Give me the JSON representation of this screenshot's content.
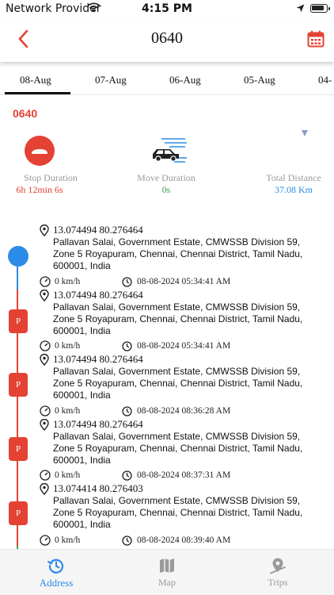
{
  "status_bar": {
    "carrier": "Network Provider",
    "time": "4:15 PM"
  },
  "header": {
    "title": "0640",
    "back_icon": "chevron-left-icon",
    "calendar_icon": "calendar-icon",
    "accent": "#e34234"
  },
  "date_tabs": [
    {
      "label": "08-Aug",
      "active": true
    },
    {
      "label": "07-Aug",
      "active": false
    },
    {
      "label": "06-Aug",
      "active": false
    },
    {
      "label": "05-Aug",
      "active": false
    },
    {
      "label": "04-",
      "active": false
    }
  ],
  "vehicle_id": "0640",
  "stats": {
    "stop_duration": {
      "label": "Stop Duration",
      "value": "6h 12min 6s",
      "color": "#e34234"
    },
    "move_duration": {
      "label": "Move Duration",
      "value": "0s",
      "color": "#3aa24a"
    },
    "total_distance": {
      "label": "Total Distance",
      "value": "37.08 Km",
      "color": "#2c8be6"
    }
  },
  "entries": [
    {
      "coords": "13.074494 80.276464",
      "address": "Pallavan Salai, Government Estate, CMWSSB Division 59, Zone 5 Royapuram, Chennai, Chennai District, Tamil Nadu, 600001, India",
      "speed": "0 km/h",
      "timestamp": "08-08-2024 05:34:41 AM"
    },
    {
      "coords": "13.074494 80.276464",
      "address": "Pallavan Salai, Government Estate, CMWSSB Division 59, Zone 5 Royapuram, Chennai, Chennai District, Tamil Nadu, 600001, India",
      "speed": "0 km/h",
      "timestamp": "08-08-2024 05:34:41 AM"
    },
    {
      "coords": "13.074494 80.276464",
      "address": "Pallavan Salai, Government Estate, CMWSSB Division 59, Zone 5 Royapuram, Chennai, Chennai District, Tamil Nadu, 600001, India",
      "speed": "0 km/h",
      "timestamp": "08-08-2024 08:36:28 AM"
    },
    {
      "coords": "13.074494 80.276464",
      "address": "Pallavan Salai, Government Estate, CMWSSB Division 59, Zone 5 Royapuram, Chennai, Chennai District, Tamil Nadu, 600001, India",
      "speed": "0 km/h",
      "timestamp": "08-08-2024 08:37:31 AM"
    },
    {
      "coords": "13.074414 80.276403",
      "address": "Pallavan Salai, Government Estate, CMWSSB Division 59, Zone 5 Royapuram, Chennai, Chennai District, Tamil Nadu, 600001, India",
      "speed": "0 km/h",
      "timestamp": "08-08-2024 08:39:40 AM"
    }
  ],
  "parking_marker": "P",
  "bottom_nav": [
    {
      "label": "Address",
      "icon": "history-icon",
      "active": true
    },
    {
      "label": "Map",
      "icon": "map-icon",
      "active": false
    },
    {
      "label": "Trips",
      "icon": "trips-icon",
      "active": false
    }
  ]
}
